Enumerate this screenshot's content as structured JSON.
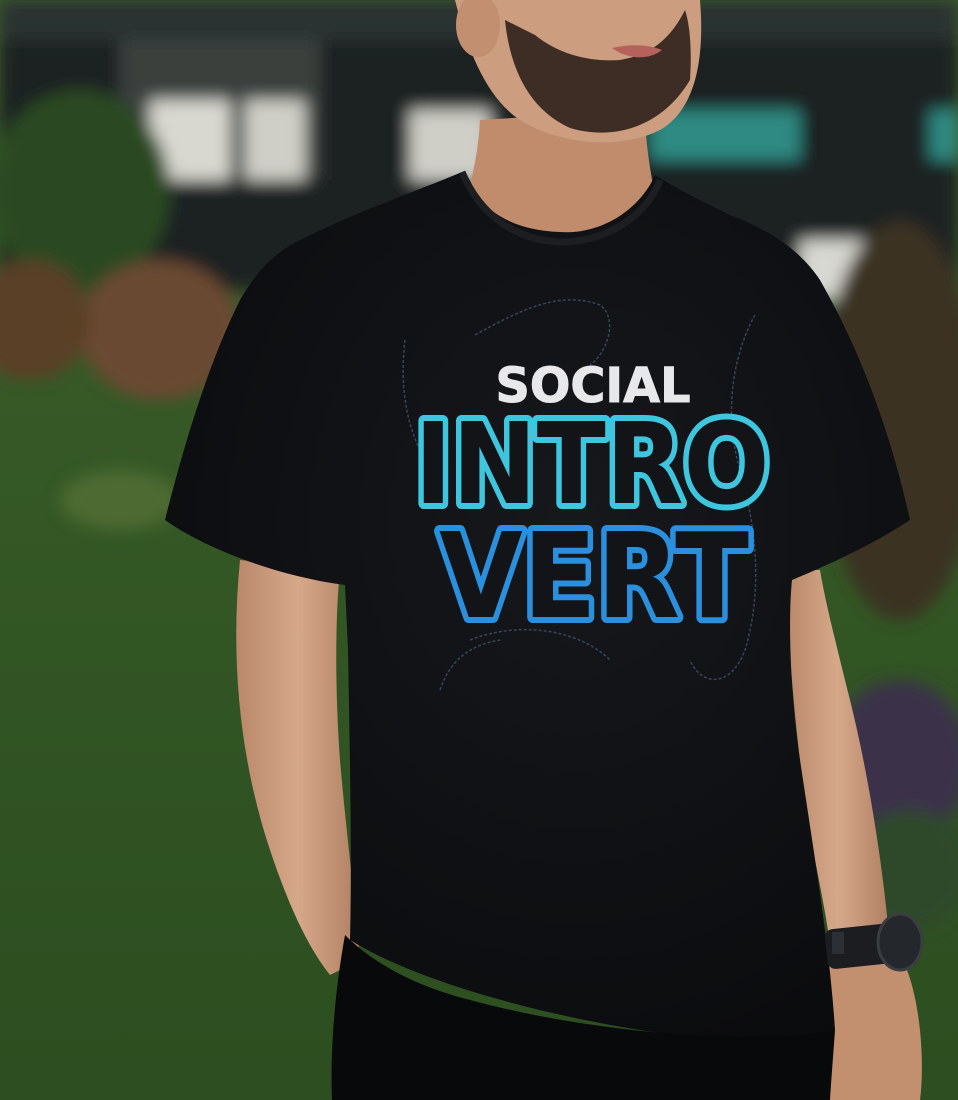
{
  "photo": {
    "subject": "man wearing black t-shirt with printed slogan",
    "colors": {
      "shirt": "#0e0f12",
      "grass": "#3f6a2c",
      "grass_dark": "#2a4a1f",
      "building": "#1c2420",
      "skin": "#c99a7c",
      "skin_shadow": "#a87a5e",
      "hair": "#2a1e18",
      "print_white": "#e8e8ea",
      "print_cyan": "#3fc6df",
      "print_blue": "#2a8fdc",
      "print_outline": "#1a1c22",
      "watch": "#1b1d20",
      "pants": "#08090b",
      "window_teal": "#2e8a82"
    }
  },
  "shirt_print": {
    "line1": "SOCIAL",
    "line2": "INTRO",
    "line3": "VERT"
  }
}
